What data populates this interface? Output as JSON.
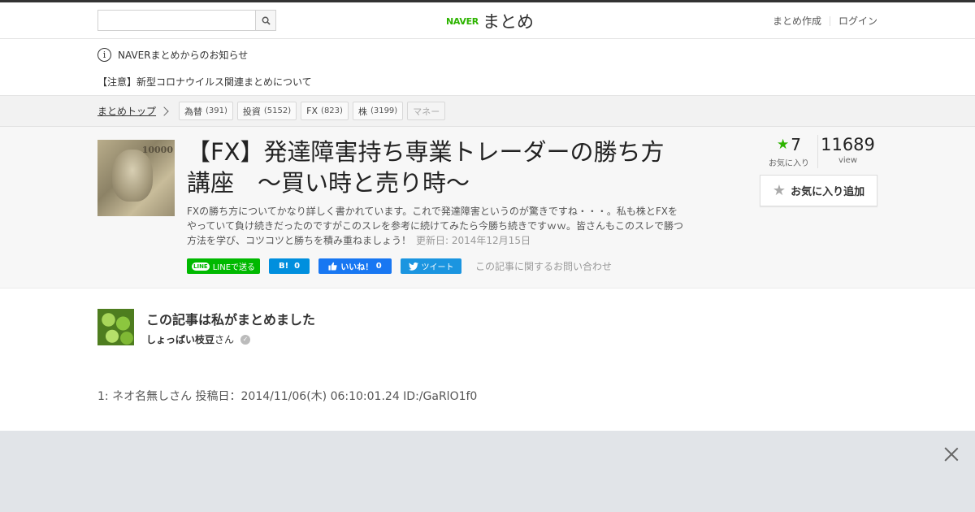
{
  "header": {
    "search_placeholder": "",
    "logo_brand": "NAVER",
    "logo_text": "まとめ",
    "links": [
      "まとめ作成",
      "ログイン"
    ]
  },
  "notice": {
    "title": "NAVERまとめからのお知らせ",
    "item": "【注意】新型コロナウイルス関連まとめについて"
  },
  "breadcrumb": {
    "home": "まとめトップ",
    "tags": [
      {
        "label": "為替",
        "count": "(391)"
      },
      {
        "label": "投資",
        "count": "(5152)"
      },
      {
        "label": "FX",
        "count": "(823)"
      },
      {
        "label": "株",
        "count": "(3199)"
      },
      {
        "label": "マネー",
        "count": ""
      }
    ]
  },
  "article": {
    "thumb_number": "10000",
    "title": "【FX】発達障害持ち専業トレーダーの勝ち方講座　～買い時と売り時～",
    "description": "FXの勝ち方についてかなり詳しく書かれています。これで発達障害というのが驚きですね・・・。私も株とFXをやっていて負け続きだったのですがこのスレを参考に続けてみたら今勝ち続きですｗｗ。皆さんもこのスレで勝つ方法を学び、コツコツと勝ちを積み重ねましょう！",
    "updated": "更新日: 2014年12月15日",
    "share": {
      "line": "LINEで送る",
      "line_icon": "LINE",
      "hatena_label": "B!",
      "hatena_count": "0",
      "fb_label": "いいね！",
      "fb_count": "0",
      "tweet": "ツイート",
      "contact": "この記事に関するお問い合わせ"
    },
    "stats": {
      "fav_count": "7",
      "fav_label": "お気に入り",
      "views": "11689",
      "views_label": "view"
    },
    "fav_button": "お気に入り追加"
  },
  "author": {
    "heading": "この記事は私がまとめました",
    "name": "しょっぱい枝豆",
    "suffix": "さん"
  },
  "post": {
    "line": "1: ネオ名無しさん 投稿日：2014/11/06(木) 06:10:01.24 ID:/GaRlO1f0"
  },
  "colors": {
    "brand_green": "#2db400",
    "line_green": "#00b900",
    "hatena_blue": "#008fde",
    "facebook_blue": "#1877f2",
    "twitter_blue": "#1b95e0"
  }
}
